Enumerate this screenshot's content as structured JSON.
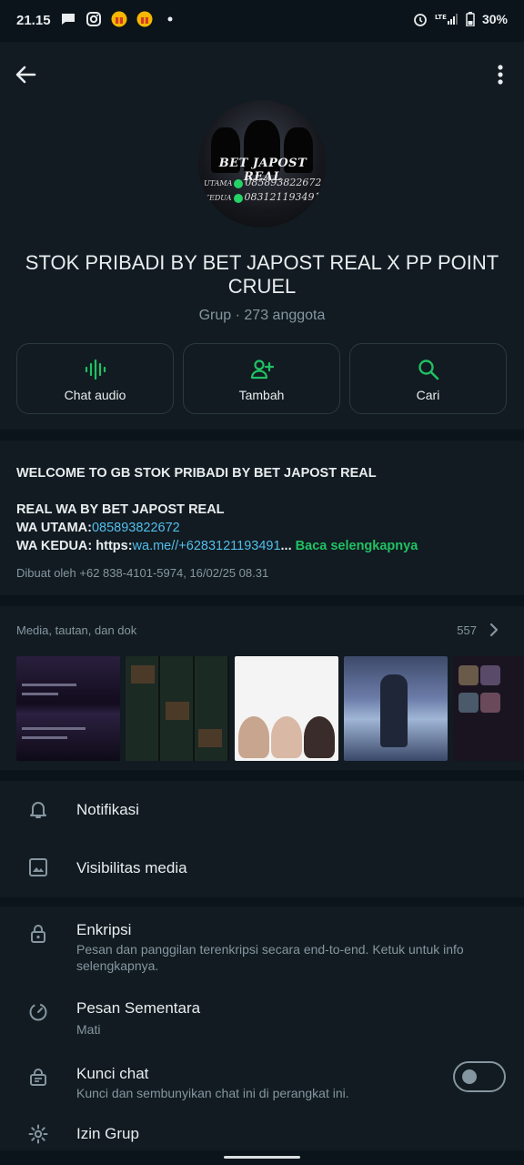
{
  "status_bar": {
    "time": "21.15",
    "battery": "30%",
    "icons": [
      "chat-bubble-icon",
      "instagram-icon",
      "gift-icon",
      "gift-icon",
      "dot-icon",
      "alarm-icon",
      "lte-signal-icon",
      "battery-icon"
    ]
  },
  "header": {
    "back_icon": "arrow-left-icon",
    "menu_icon": "more-vert-icon",
    "avatar": {
      "title": "BET JAPOST REAL",
      "line1_label": "UTAMA",
      "line1_number": "085893822672",
      "line2_label": "KEDUA",
      "line2_number": "083121193491"
    },
    "group_name": "STOK PRIBADI BY BET JAPOST REAL X PP POINT CRUEL",
    "subtitle": "Grup · 273 anggota"
  },
  "actions": [
    {
      "label": "Chat audio",
      "icon": "audio-wave-icon"
    },
    {
      "label": "Tambah",
      "icon": "add-person-icon"
    },
    {
      "label": "Cari",
      "icon": "search-icon"
    }
  ],
  "description": {
    "line1": "WELCOME TO GB STOK PRIBADI BY BET JAPOST REAL",
    "line2": "REAL WA BY BET JAPOST REAL",
    "line3_prefix": "WA UTAMA:",
    "line3_link": "085893822672",
    "line4_prefix": "WA KEDUA: https:",
    "line4_link": "wa.me//+6283121193491",
    "line4_ellipsis": "...",
    "read_more": "Baca selengkapnya",
    "created": "Dibuat oleh +62 838-4101-5974, 16/02/25 08.31"
  },
  "media": {
    "title": "Media, tautan, dan dok",
    "count": "557"
  },
  "settings": {
    "notifications": {
      "label": "Notifikasi",
      "icon": "bell-icon"
    },
    "media_visibility": {
      "label": "Visibilitas media",
      "icon": "image-icon"
    },
    "encryption": {
      "label": "Enkripsi",
      "desc": "Pesan dan panggilan terenkripsi secara end-to-end. Ketuk untuk info selengkapnya.",
      "icon": "lock-icon"
    },
    "disappearing": {
      "label": "Pesan Sementara",
      "value": "Mati",
      "icon": "timer-icon"
    },
    "chat_lock": {
      "label": "Kunci chat",
      "desc": "Kunci dan sembunyikan chat ini di perangkat ini.",
      "icon": "chat-lock-icon",
      "enabled": false
    },
    "group_permissions": {
      "label": "Izin Grup",
      "icon": "settings-gear-icon"
    }
  },
  "colors": {
    "background": "#0b141a",
    "surface": "#111b21",
    "accent_green": "#21c063",
    "link_blue": "#53bdeb",
    "muted_text": "#8696a0"
  }
}
